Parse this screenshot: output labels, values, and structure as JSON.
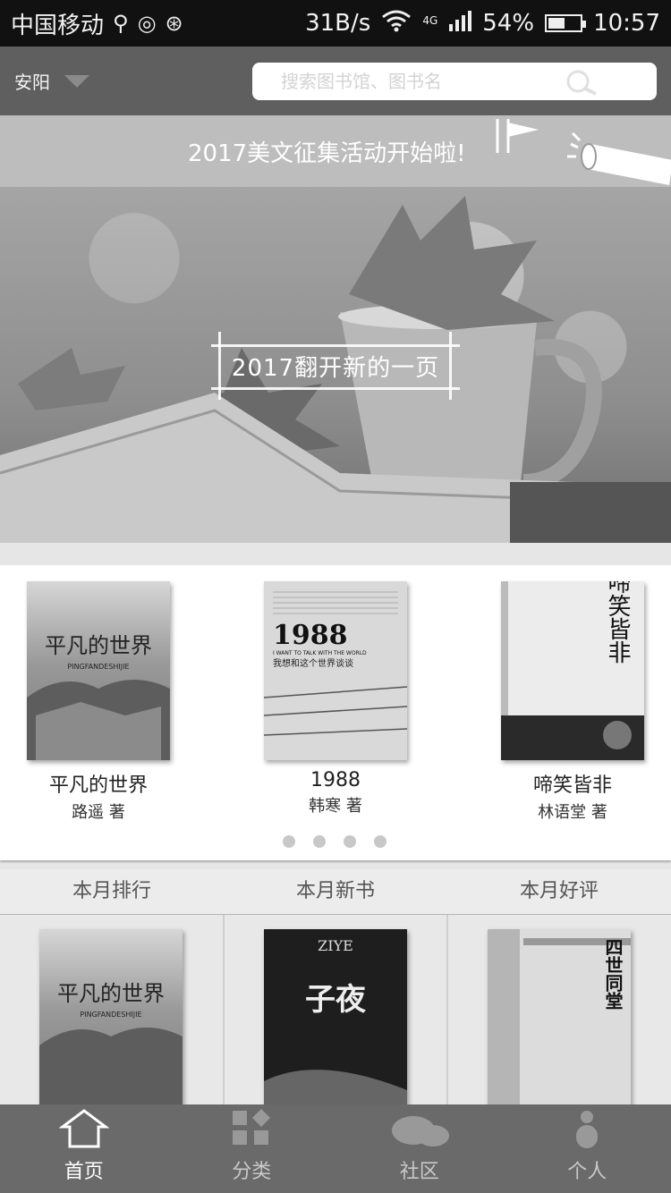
{
  "status_bar": {
    "carrier": "中国移动",
    "speed": "31B/s",
    "network": "4G",
    "battery": "54%",
    "battery_level": 0.54,
    "time": "10:57"
  },
  "header": {
    "city": "安阳",
    "search_placeholder": "搜索图书馆、图书名"
  },
  "notice": {
    "text": "2017美文征集活动开始啦!"
  },
  "hero": {
    "caption": "2017翻开新的一页"
  },
  "featured": {
    "books": [
      {
        "title": "平凡的世界",
        "author": "路遥 著",
        "cover_title": "平凡的世界",
        "cover_sub": "PINGFANDESHIJIE"
      },
      {
        "title": "1988",
        "author": "韩寒 著",
        "cover_title": "1988",
        "cover_sub": "I WANT TO TALK WITH THE WORLD",
        "cover_cn": "我想和这个世界谈谈"
      },
      {
        "title": "啼笑皆非",
        "author": "林语堂 著",
        "cover_title": "啼笑皆非"
      }
    ],
    "page_count": 4
  },
  "ranking": {
    "tabs": [
      "本月排行",
      "本月新书",
      "本月好评"
    ],
    "covers": [
      {
        "title": "平凡的世界",
        "sub": "PINGFANDESHIJIE"
      },
      {
        "title": "子夜",
        "sub": "ZIYE"
      },
      {
        "title": "四世同堂"
      }
    ]
  },
  "tabbar": {
    "items": [
      {
        "label": "首页",
        "icon": "home-icon",
        "active": true
      },
      {
        "label": "分类",
        "icon": "category-icon",
        "active": false
      },
      {
        "label": "社区",
        "icon": "community-icon",
        "active": false
      },
      {
        "label": "个人",
        "icon": "profile-icon",
        "active": false
      }
    ]
  }
}
